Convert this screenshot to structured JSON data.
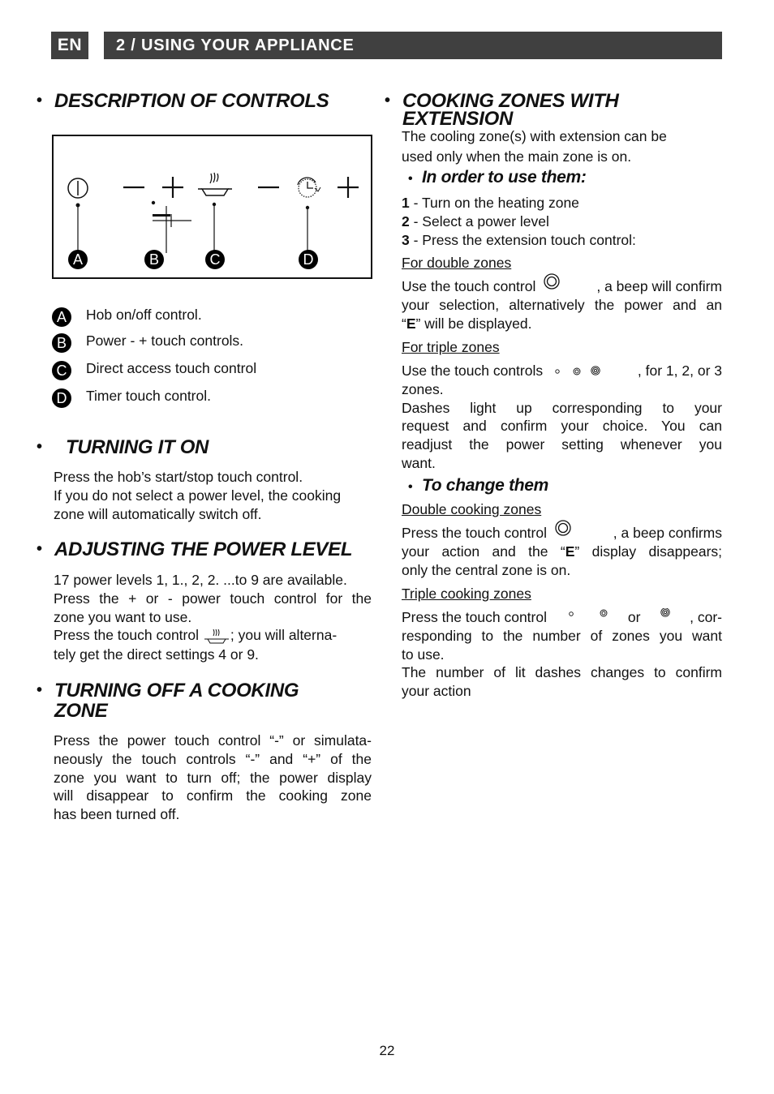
{
  "header": {
    "lang": "EN",
    "section": "2 / USING YOUR APPLIANCE"
  },
  "left": {
    "description": {
      "title": "DESCRIPTION OF CONTROLS",
      "diagram_labels": [
        "A",
        "B",
        "C",
        "D"
      ],
      "legend": [
        {
          "badge": "A",
          "text": "Hob on/off control."
        },
        {
          "badge": "B",
          "text": "Power - + touch controls."
        },
        {
          "badge": "C",
          "text": "Direct access touch control"
        },
        {
          "badge": "D",
          "text": "Timer touch control."
        }
      ],
      "icons": [
        "power-icon",
        "minus-icon",
        "plus-icon",
        "direct-access-pan-icon",
        "minus-icon",
        "timer-icon",
        "plus-icon"
      ]
    },
    "turning_on": {
      "title": "TURNING IT ON",
      "lines": [
        "Press the hob’s start/stop touch control.",
        "If you do not select a power level, the cooking",
        "zone will automatically switch off."
      ]
    },
    "power_level": {
      "title": "ADJUSTING THE POWER LEVEL",
      "line1": "17 power levels 1, 1., 2, 2. ...to 9 are available.",
      "line2": "Press the + or - power touch control for the",
      "line3": "zone you want to use.",
      "line4a": "Press the touch control",
      "line4b": "; you will alterna-",
      "line5": "tely get the direct settings 4 or 9."
    },
    "turning_off": {
      "title_line1": "TURNING OFF A COOKING",
      "title_line2": "ZONE",
      "lines": [
        "Press the power touch control “-” or simulata-",
        "neously the touch controls “-” and “+” of the",
        "zone you want to turn off; the power display",
        "will disappear to confirm the cooking zone",
        "has been turned off."
      ]
    }
  },
  "right": {
    "extension": {
      "title_line1": "COOKING ZONES  WITH",
      "title_line2": "EXTENSION",
      "intro": [
        "The cooling zone(s) with extension can be",
        "used only when the main zone is on."
      ]
    },
    "order": {
      "title": "In order to use them:",
      "steps": [
        {
          "num": "1",
          "text": " - Turn on the heating zone"
        },
        {
          "num": "2",
          "text": " - Select a power level"
        },
        {
          "num": "3",
          "text": " - Press the extension touch control:"
        }
      ],
      "double_heading": "For double zones",
      "double_a": "Use the touch control",
      "double_b": ", a beep will confirm",
      "double_line2": "your selection, alternatively the power and an",
      "double_line3_pre": "“",
      "double_line3_e": "E",
      "double_line3_post": "” will be displayed.",
      "triple_heading": "For triple zones",
      "triple_a": "Use the touch controls",
      "triple_b": ", for 1, 2, or 3",
      "triple_line2": "zones.",
      "dashes": [
        "Dashes light up corresponding to your",
        "request and confirm your choice. You can",
        "readjust the power setting whenever you",
        "want."
      ]
    },
    "change": {
      "title": "To change them",
      "double_heading": "Double cooking zones",
      "double_a": "Press the touch control",
      "double_b": ", a beep confirms",
      "double_line2_pre": "your action and the “",
      "double_line2_e": "E",
      "double_line2_post": "” display disappears;",
      "double_line3": "only the central zone is on.",
      "triple_heading": "Triple cooking zones",
      "triple_a": "Press the touch control",
      "triple_or": "or",
      "triple_b": ", cor-",
      "triple_lines": [
        "responding to the number of zones you want",
        "to use.",
        "The number of lit dashes changes to confirm",
        "your action"
      ]
    }
  },
  "footer": {
    "page_number": "22"
  }
}
